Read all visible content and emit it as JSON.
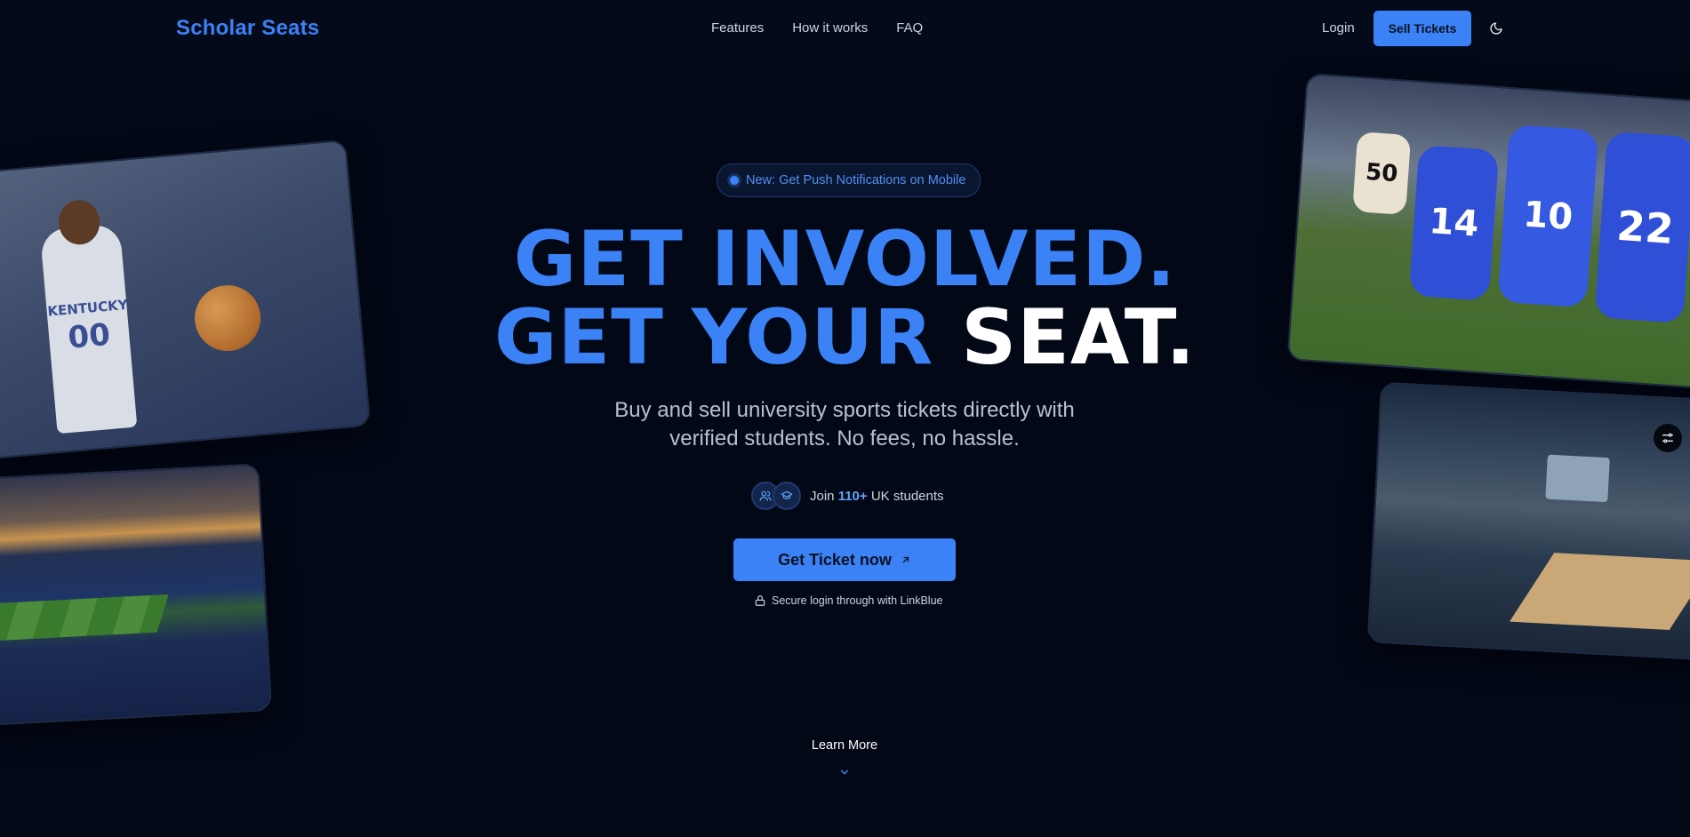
{
  "brand": "Scholar Seats",
  "nav": {
    "links": [
      "Features",
      "How it works",
      "FAQ"
    ],
    "login": "Login",
    "sell_tickets": "Sell Tickets",
    "theme_icon": "moon-icon"
  },
  "hero": {
    "badge": "New: Get Push Notifications on Mobile",
    "headline_line1": "GET INVOLVED.",
    "headline_line2_blue": "GET YOUR ",
    "headline_line2_white": "SEAT.",
    "subtitle": "Buy and sell university sports tickets directly with verified students. No fees, no hassle.",
    "social_prefix": "Join ",
    "social_count": "110+",
    "social_suffix": " UK students",
    "cta": "Get Ticket now",
    "secure_note": "Secure login through with LinkBlue",
    "learn_more": "Learn More"
  },
  "photos": {
    "basketball_jersey": "KENTUCKY",
    "basketball_number": "00",
    "football_numbers": [
      "50",
      "14",
      "10",
      "22"
    ]
  },
  "colors": {
    "background": "#030817",
    "accent": "#3b82f6",
    "headline_white": "#ffffff"
  }
}
